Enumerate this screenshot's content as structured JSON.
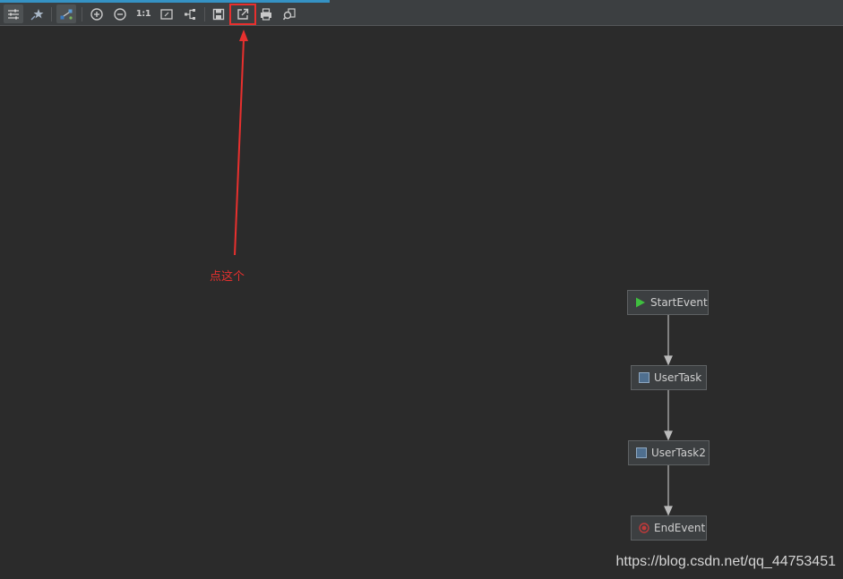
{
  "colors": {
    "background": "#2b2b2b",
    "toolbar": "#3c3f41",
    "progress_accent": "#3592c4",
    "annotation": "#e8302e",
    "node_fill": "#3c3f41",
    "node_border": "#5e6163",
    "edge": "#bbbbbb",
    "start_icon": "#3fbf3f",
    "end_icon": "#c03a3a",
    "task_icon": "#4f6f8f"
  },
  "toolbar": {
    "icons": [
      "settings-sliders-icon",
      "pin-star-icon",
      "layout-graph-icon",
      "zoom-in-icon",
      "zoom-out-icon",
      "actual-size-icon",
      "fit-content-icon",
      "share-layout-icon",
      "save-icon",
      "export-icon",
      "print-icon",
      "find-icon"
    ],
    "actual_size_label": "1:1"
  },
  "annotation": {
    "text": "点这个"
  },
  "diagram": {
    "nodes": [
      {
        "id": "start",
        "label": "StartEvent",
        "icon": "start-event-icon"
      },
      {
        "id": "task1",
        "label": "UserTask",
        "icon": "user-task-icon"
      },
      {
        "id": "task2",
        "label": "UserTask2",
        "icon": "user-task-icon"
      },
      {
        "id": "end",
        "label": "EndEvent",
        "icon": "end-event-icon"
      }
    ],
    "edges": [
      {
        "from": "start",
        "to": "task1"
      },
      {
        "from": "task1",
        "to": "task2"
      },
      {
        "from": "task2",
        "to": "end"
      }
    ]
  },
  "watermark": {
    "text": "https://blog.csdn.net/qq_44753451"
  }
}
